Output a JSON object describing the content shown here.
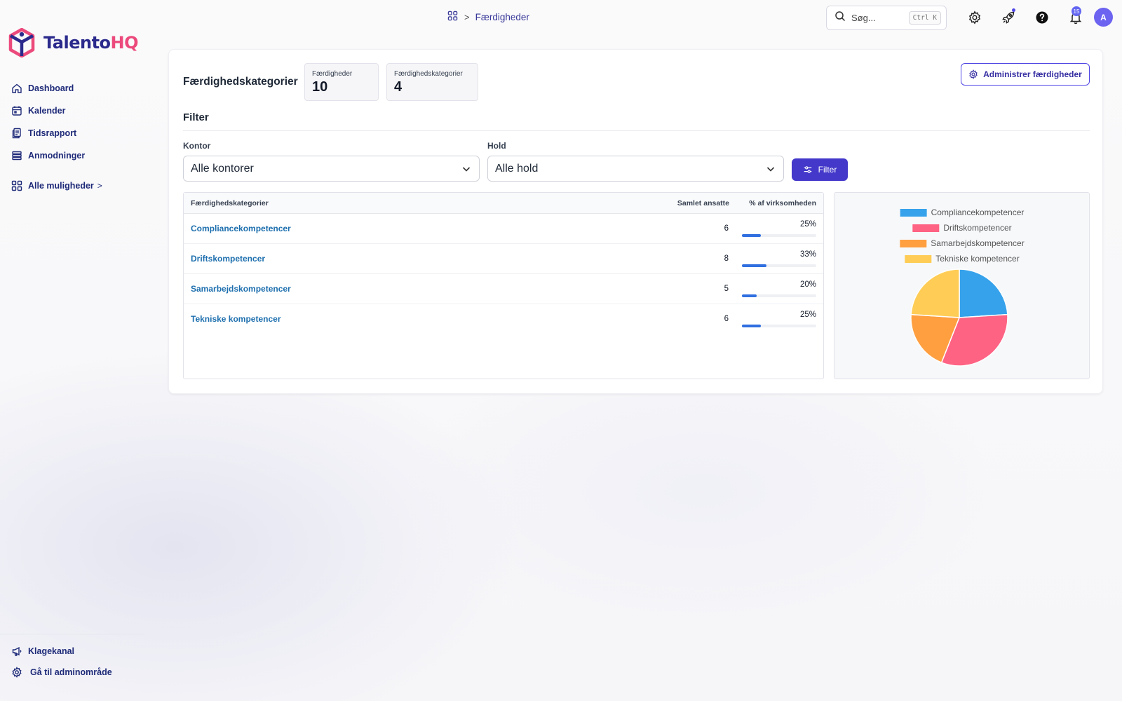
{
  "brand": {
    "name_main": "Talento",
    "name_accent": "HQ"
  },
  "sidebar": {
    "items": [
      {
        "label": "Dashboard",
        "icon": "home-icon"
      },
      {
        "label": "Kalender",
        "icon": "calendar-icon"
      },
      {
        "label": "Tidsrapport",
        "icon": "timesheet-icon"
      },
      {
        "label": "Anmodninger",
        "icon": "list-icon"
      }
    ],
    "more": {
      "label": "Alle muligheder",
      "chevron": ">",
      "icon": "grid-icon"
    },
    "bottom": [
      {
        "label": "Klagekanal",
        "icon": "megaphone-icon"
      },
      {
        "label": "Gå til adminområde",
        "icon": "gear-icon"
      }
    ]
  },
  "topbar": {
    "breadcrumb": {
      "separator": ">",
      "current": "Færdigheder"
    },
    "search": {
      "placeholder": "Søg...",
      "shortcut": "Ctrl K"
    },
    "notifications_count": "15",
    "avatar_initial": "A"
  },
  "page": {
    "title": "Færdighedskategorier",
    "stats": [
      {
        "label": "Færdigheder",
        "value": "10"
      },
      {
        "label": "Færdighedskategorier",
        "value": "4"
      }
    ],
    "admin_button": "Administrer færdigheder",
    "filter": {
      "title": "Filter",
      "office_label": "Kontor",
      "office_value": "Alle kontorer",
      "team_label": "Hold",
      "team_value": "Alle hold",
      "button": "Filter"
    },
    "table": {
      "headers": [
        "Færdighedskategorier",
        "Samlet ansatte",
        "% af virksomheden"
      ],
      "rows": [
        {
          "name": "Compliancekompetencer",
          "count": "6",
          "percent": "25%",
          "fraction": 0.25
        },
        {
          "name": "Driftskompetencer",
          "count": "8",
          "percent": "33%",
          "fraction": 0.33
        },
        {
          "name": "Samarbejdskompetencer",
          "count": "5",
          "percent": "20%",
          "fraction": 0.2
        },
        {
          "name": "Tekniske kompetencer",
          "count": "6",
          "percent": "25%",
          "fraction": 0.25
        }
      ]
    }
  },
  "chart_data": {
    "type": "pie",
    "categories": [
      "Compliancekompetencer",
      "Driftskompetencer",
      "Samarbejdskompetencer",
      "Tekniske kompetencer"
    ],
    "values": [
      6,
      8,
      5,
      6
    ],
    "colors": [
      "#36a2eb",
      "#ff6384",
      "#ff9f40",
      "#ffcd56"
    ],
    "legend": "top"
  },
  "colors": {
    "accent": "#4338ca",
    "link": "#1d6fae",
    "progress": "#2f6fe0",
    "brand_pink": "#ec4a7c",
    "brand_navy": "#2b2a8c"
  }
}
